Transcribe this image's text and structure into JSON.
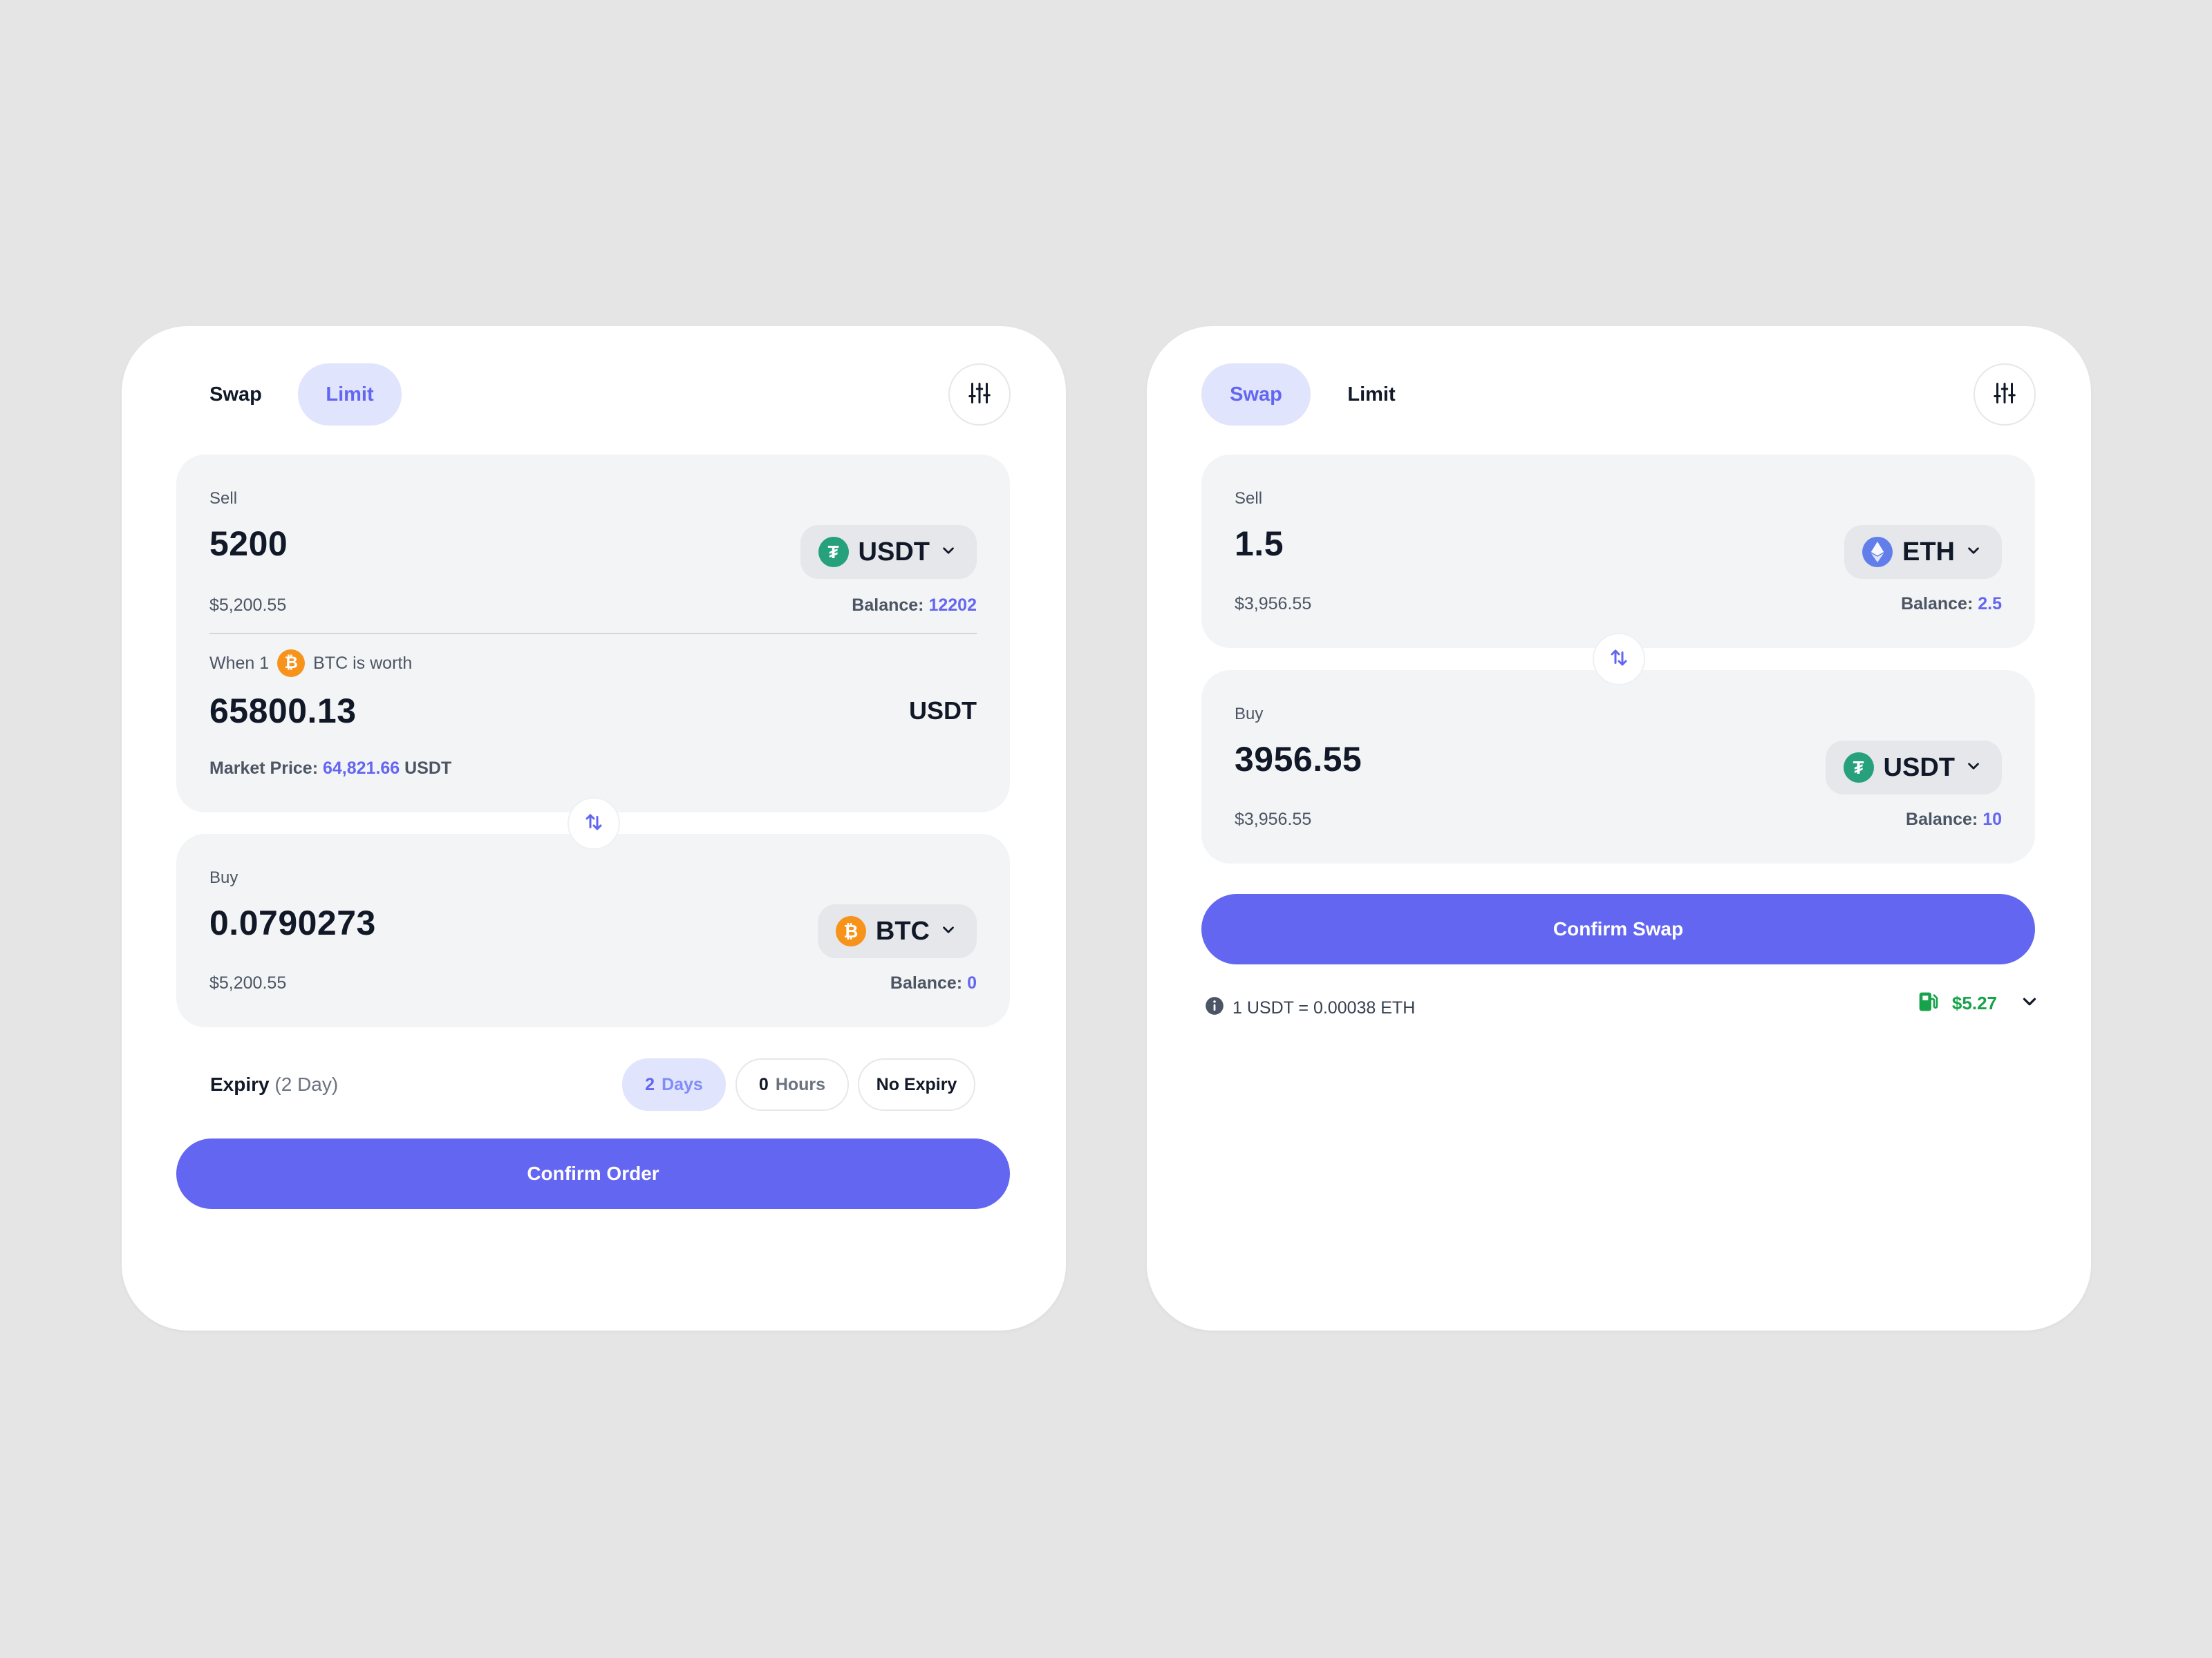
{
  "colors": {
    "accent": "#6366f1",
    "accent_soft": "#e0e4fc",
    "panel_bg": "#f3f4f6",
    "gas_green": "#16a34a",
    "usdt": "#26a17b",
    "btc": "#f7931a",
    "eth": "#627eea"
  },
  "limit_card": {
    "tabs": {
      "swap": "Swap",
      "limit": "Limit",
      "active": "limit"
    },
    "settings_icon": "sliders-icon",
    "sell": {
      "label": "Sell",
      "amount": "5200",
      "fiat": "$5,200.55",
      "balance_label": "Balance:",
      "balance_value": "12202",
      "token": "USDT",
      "token_icon": "tether-icon"
    },
    "rate": {
      "prefix": "When 1",
      "token_icon": "bitcoin-icon",
      "suffix": "BTC is worth",
      "amount": "65800.13",
      "unit": "USDT",
      "market_label": "Market Price:",
      "market_value": "64,821.66",
      "market_unit": "USDT"
    },
    "buy": {
      "label": "Buy",
      "amount": "0.0790273",
      "fiat": "$5,200.55",
      "balance_label": "Balance:",
      "balance_value": "0",
      "token": "BTC",
      "token_icon": "bitcoin-icon"
    },
    "expiry": {
      "label": "Expiry",
      "detail": "(2 Day)",
      "options": [
        {
          "num": "2",
          "unit": "Days",
          "active": true
        },
        {
          "num": "0",
          "unit": "Hours",
          "active": false
        },
        {
          "num": "",
          "unit": "No Expiry",
          "active": false
        }
      ]
    },
    "confirm_label": "Confirm Order"
  },
  "swap_card": {
    "tabs": {
      "swap": "Swap",
      "limit": "Limit",
      "active": "swap"
    },
    "settings_icon": "sliders-icon",
    "sell": {
      "label": "Sell",
      "amount": "1.5",
      "fiat": "$3,956.55",
      "balance_label": "Balance:",
      "balance_value": "2.5",
      "token": "ETH",
      "token_icon": "ethereum-icon"
    },
    "buy": {
      "label": "Buy",
      "amount": "3956.55",
      "fiat": "$3,956.55",
      "balance_label": "Balance:",
      "balance_value": "10",
      "token": "USDT",
      "token_icon": "tether-icon"
    },
    "confirm_label": "Confirm Swap",
    "rate_text": "1 USDT = 0.00038 ETH",
    "gas_fee": "$5.27"
  }
}
